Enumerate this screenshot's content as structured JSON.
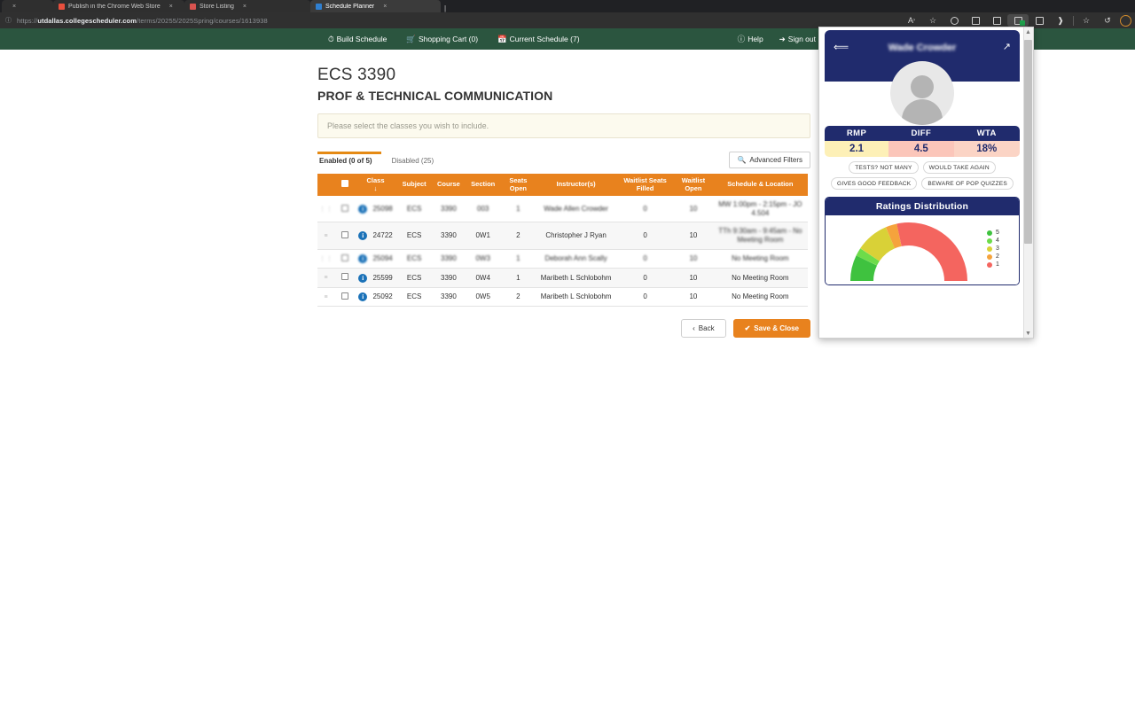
{
  "browser": {
    "tabs": [
      {
        "title": "",
        "favicon_color": "#2b2b2b",
        "close": "×",
        "active": false
      },
      {
        "title": "Publish in the Chrome Web Store",
        "favicon_color": "#e84f3d",
        "close": "×",
        "active": false
      },
      {
        "title": "Store Listing",
        "favicon_color": "#d9534f",
        "close": "×",
        "active": false
      },
      {
        "title": "Schedule Planner",
        "favicon_color": "#2f7fd0",
        "close": "×",
        "active": true
      }
    ],
    "url_prefix": "https://",
    "url_host": "utdallas.collegescheduler.com",
    "url_path": "/terms/20255/2025Spring/courses/1613938",
    "toolbar_icons": [
      "read-aloud-icon",
      "add-favorite-icon",
      "copilot-icon",
      "split-screen-icon",
      "collections-icon",
      "extensions-icon",
      "browser-essentials-icon",
      "favorites-icon",
      "history-icon",
      "profile-avatar-icon"
    ]
  },
  "nav": {
    "build_schedule": "Build Schedule",
    "shopping_cart": "Shopping Cart (0)",
    "current_schedule": "Current Schedule (7)",
    "help": "Help",
    "sign_out": "Sign out"
  },
  "course": {
    "code": "ECS 3390",
    "title": "PROF & TECHNICAL COMMUNICATION",
    "notice": "Please select the classes you wish to include."
  },
  "subtabs": {
    "enabled": "Enabled (0 of 5)",
    "disabled": "Disabled (25)",
    "advanced_filters": "Advanced Filters"
  },
  "table": {
    "headers": [
      "",
      "",
      "Class",
      "Subject",
      "Course",
      "Section",
      "Seats Open",
      "Instructor(s)",
      "Waitlist Seats Filled",
      "Waitlist Open",
      "Schedule & Location"
    ],
    "sort_indicator": "↓",
    "rows": [
      {
        "class": "25098",
        "subject": "ECS",
        "course": "3390",
        "section": "003",
        "seats_open": "1",
        "instructor": "Wade Allen Crowder",
        "waitlist_filled": "0",
        "waitlist_open": "10",
        "schedule": "MW 1:00pm - 2:15pm - JO 4.504",
        "blurred": true
      },
      {
        "class": "24722",
        "subject": "ECS",
        "course": "3390",
        "section": "0W1",
        "seats_open": "2",
        "instructor": "Christopher J Ryan",
        "waitlist_filled": "0",
        "waitlist_open": "10",
        "schedule": "TTh 9:30am - 9:45am - No Meeting Room",
        "blurred": false,
        "schedule_blurred": true
      },
      {
        "class": "25094",
        "subject": "ECS",
        "course": "3390",
        "section": "0W3",
        "seats_open": "1",
        "instructor": "Deborah Ann Scally",
        "waitlist_filled": "0",
        "waitlist_open": "10",
        "schedule": "No Meeting Room",
        "blurred": true
      },
      {
        "class": "25599",
        "subject": "ECS",
        "course": "3390",
        "section": "0W4",
        "seats_open": "1",
        "instructor": "Maribeth L Schlobohm",
        "waitlist_filled": "0",
        "waitlist_open": "10",
        "schedule": "No Meeting Room",
        "blurred": false
      },
      {
        "class": "25092",
        "subject": "ECS",
        "course": "3390",
        "section": "0W5",
        "seats_open": "2",
        "instructor": "Maribeth L Schlobohm",
        "waitlist_filled": "0",
        "waitlist_open": "10",
        "schedule": "No Meeting Room",
        "blurred": false
      }
    ]
  },
  "buttons": {
    "back": "Back",
    "save_close": "Save & Close"
  },
  "rmp": {
    "professor_name": "Wade Crowder",
    "stats": {
      "labels": [
        "RMP",
        "DIFF",
        "WTA"
      ],
      "values": [
        "2.1",
        "4.5",
        "18%"
      ]
    },
    "tags": [
      "TESTS? NOT MANY",
      "WOULD TAKE AGAIN",
      "GIVES GOOD FEEDBACK",
      "BEWARE OF POP QUIZZES"
    ],
    "ratings_title": "Ratings Distribution",
    "chart_data": {
      "type": "pie",
      "title": "Ratings Distribution",
      "categories": [
        "5",
        "4",
        "3",
        "2",
        "1"
      ],
      "values": [
        10,
        4,
        18,
        4,
        64
      ],
      "colors": [
        "#3fc23f",
        "#6ddc4a",
        "#d9d137",
        "#f5a33c",
        "#f4655f"
      ],
      "legend": "right",
      "note": "half-donut gauge, values are percent of ratings"
    },
    "colors": {
      "header_navy": "#202b6d",
      "rmp_bg": "#fdf0b7",
      "diff_bg": "#fbc6ba",
      "wta_bg": "#fbd4c5"
    }
  },
  "theme": {
    "nav_green": "#2b553f",
    "table_header_orange": "#e8821e",
    "accent_orange": "#e58a14"
  }
}
